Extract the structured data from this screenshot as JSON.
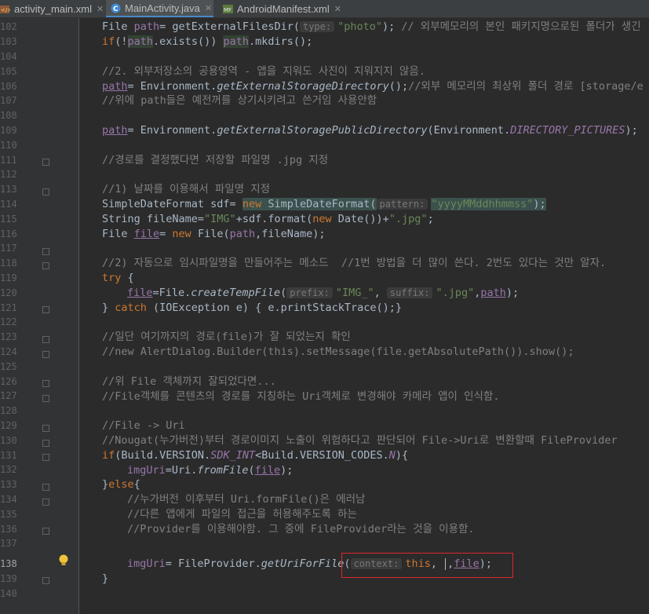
{
  "tabs": [
    {
      "label": "activity_main.xml",
      "icon": "xml-layout-icon",
      "active": false
    },
    {
      "label": "MainActivity.java",
      "icon": "java-class-icon",
      "active": true
    },
    {
      "label": "AndroidManifest.xml",
      "icon": "manifest-icon",
      "active": false
    }
  ],
  "line_numbers": [
    "102",
    "103",
    "104",
    "105",
    "106",
    "107",
    "108",
    "109",
    "110",
    "111",
    "112",
    "113",
    "114",
    "115",
    "116",
    "117",
    "118",
    "119",
    "120",
    "121",
    "122",
    "123",
    "124",
    "125",
    "126",
    "127",
    "128",
    "129",
    "130",
    "131",
    "132",
    "133",
    "134",
    "135",
    "136",
    "137",
    "138",
    "139",
    "140"
  ],
  "current_line": "138",
  "lines": {
    "l102_a": "File ",
    "l102_var": "path",
    "l102_b": "= getExternalFilesDir(",
    "l102_hint": "type:",
    "l102_str": "\"photo\"",
    "l102_c": ");",
    "l102_cm": " // 외부메모리의 본인 패키지명으로된 폴더가 생긴",
    "l103_kw": "if",
    "l103_a": "(!",
    "l103_var": "path",
    "l103_b": ".exists()) ",
    "l103_var2": "path",
    "l103_c": ".mkdirs();",
    "l105_cm": "//2. 외부저장소의 공용영역 - 앱을 지워도 사진이 지워지지 않음.",
    "l106_var": "path",
    "l106_a": "= Environment.",
    "l106_it": "getExternalStorageDirectory",
    "l106_b": "();",
    "l106_cm": "//외부 메모리의 최상위 폴더 경로 [storage/e",
    "l107_cm": "//위에 path들은 예전꺼를 상기시키려고 쓴거임 사용안함",
    "l109_var": "path",
    "l109_a": "= Environment.",
    "l109_it": "getExternalStoragePublicDirectory",
    "l109_b": "(Environment.",
    "l109_sf": "DIRECTORY_PICTURES",
    "l109_c": ");",
    "l111_cm": "//경로를 결정했다면 저장할 파일명 .jpg 지정",
    "l113_cm": "//1) 날짜를 이용해서 파일명 지정",
    "l114_a": "SimpleDateFormat sdf= ",
    "l114_kw": "new",
    "l114_b": " SimpleDateFormat(",
    "l114_hint": "pattern:",
    "l114_str": "\"yyyyMMddhhmmss\"",
    "l114_c": ");",
    "l115_a": "String fileName=",
    "l115_str": "\"IMG\"",
    "l115_b": "+sdf.format(",
    "l115_kw": "new",
    "l115_c": " Date())+",
    "l115_str2": "\".jpg\"",
    "l115_d": ";",
    "l116_a": "File ",
    "l116_var": "file",
    "l116_b": "= ",
    "l116_kw": "new",
    "l116_c": " File(",
    "l116_var2": "path",
    "l116_d": ",fileName);",
    "l118_cm": "//2) 자동으로 임시파일명을 만들어주는 메소드  //1번 방법을 더 많이 쓴다. 2번도 있다는 것만 알자.",
    "l119_kw": "try",
    "l119_a": " {",
    "l120_var": "file",
    "l120_a": "=File.",
    "l120_it": "createTempFile",
    "l120_b": "(",
    "l120_hint1": "prefix:",
    "l120_str1": "\"IMG_\"",
    "l120_c": ", ",
    "l120_hint2": "suffix:",
    "l120_str2": "\".jpg\"",
    "l120_d": ",",
    "l120_var2": "path",
    "l120_e": ");",
    "l121_a": "} ",
    "l121_kw": "catch",
    "l121_b": " (IOException e) { e.printStackTrace();}",
    "l123_cm": "//일단 여기까지의 경로(file)가 잘 되었는지 확인",
    "l124_cm": "//new AlertDialog.Builder(this).setMessage(file.getAbsolutePath()).show();",
    "l126_cm": "//위 File 객체까지 잘되었다면...",
    "l127_cm": "//File객체를 콘텐츠의 경로를 지칭하는 Uri객체로 변경해야 카메라 앱이 인식함.",
    "l129_cm": "//File -> Uri",
    "l130_cm": "//Nougat(누가버전)부터 경로이미지 노출이 위험하다고 판단되어 File->Uri로 변환할때 FileProvider",
    "l131_kw": "if",
    "l131_a": "(Build.VERSION.",
    "l131_sf": "SDK_INT",
    "l131_b": "<Build.VERSION_CODES.",
    "l131_sf2": "N",
    "l131_c": "){",
    "l132_var": "imgUri",
    "l132_a": "=Uri.",
    "l132_it": "fromFile",
    "l132_b": "(",
    "l132_var2": "file",
    "l132_c": ");",
    "l133_a": "}",
    "l133_kw": "else",
    "l133_b": "{",
    "l134_cm": "//누가버전 이후부터 Uri.formFile()은 에러남",
    "l135_cm": "//다른 앱에게 파일의 접근을 허용해주도록 하는",
    "l136_cm": "//Provider를 이용해야함. 그 중에 FileProvider라는 것을 이용함.",
    "l138_var": "imgUri",
    "l138_a": "= FileProvider.",
    "l138_it": "getUriForFile",
    "l138_b": "(",
    "l138_hint": "context:",
    "l138_kw": "this",
    "l138_c": ", ",
    "l138_d": ",",
    "l138_var2": "file",
    "l138_e": ");",
    "l139_a": "}"
  },
  "colors": {
    "background": "#2b2b2b",
    "keyword": "#cc7832",
    "string": "#6a8759",
    "comment": "#808080",
    "field": "#9876aa",
    "text": "#a9b7c6",
    "highlight_box": "#e0262a"
  }
}
